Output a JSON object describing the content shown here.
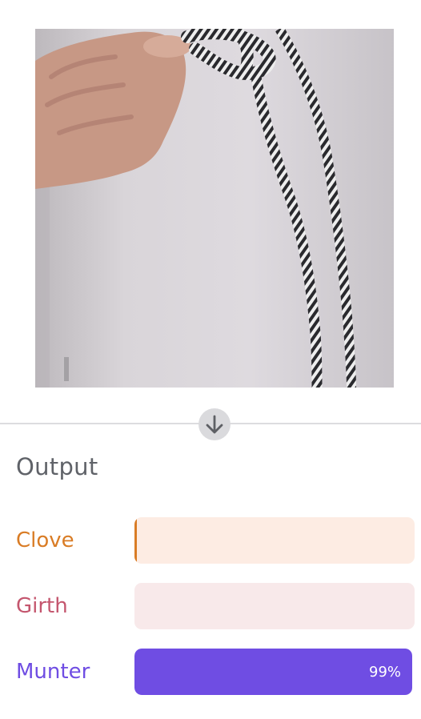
{
  "output": {
    "title": "Output",
    "predictions": [
      {
        "label": "Clove",
        "score": 0.005,
        "percent_text": "",
        "color": "#d97c25",
        "track_color": "#fdece3"
      },
      {
        "label": "Girth",
        "score": 0.0,
        "percent_text": "",
        "color": "#c4566e",
        "track_color": "#f8e9ea"
      },
      {
        "label": "Munter",
        "score": 0.99,
        "percent_text": "99%",
        "color": "#6f4de3",
        "track_color": "#ffffff"
      }
    ]
  },
  "icons": {
    "divider_toggle": "arrow-down-icon"
  }
}
